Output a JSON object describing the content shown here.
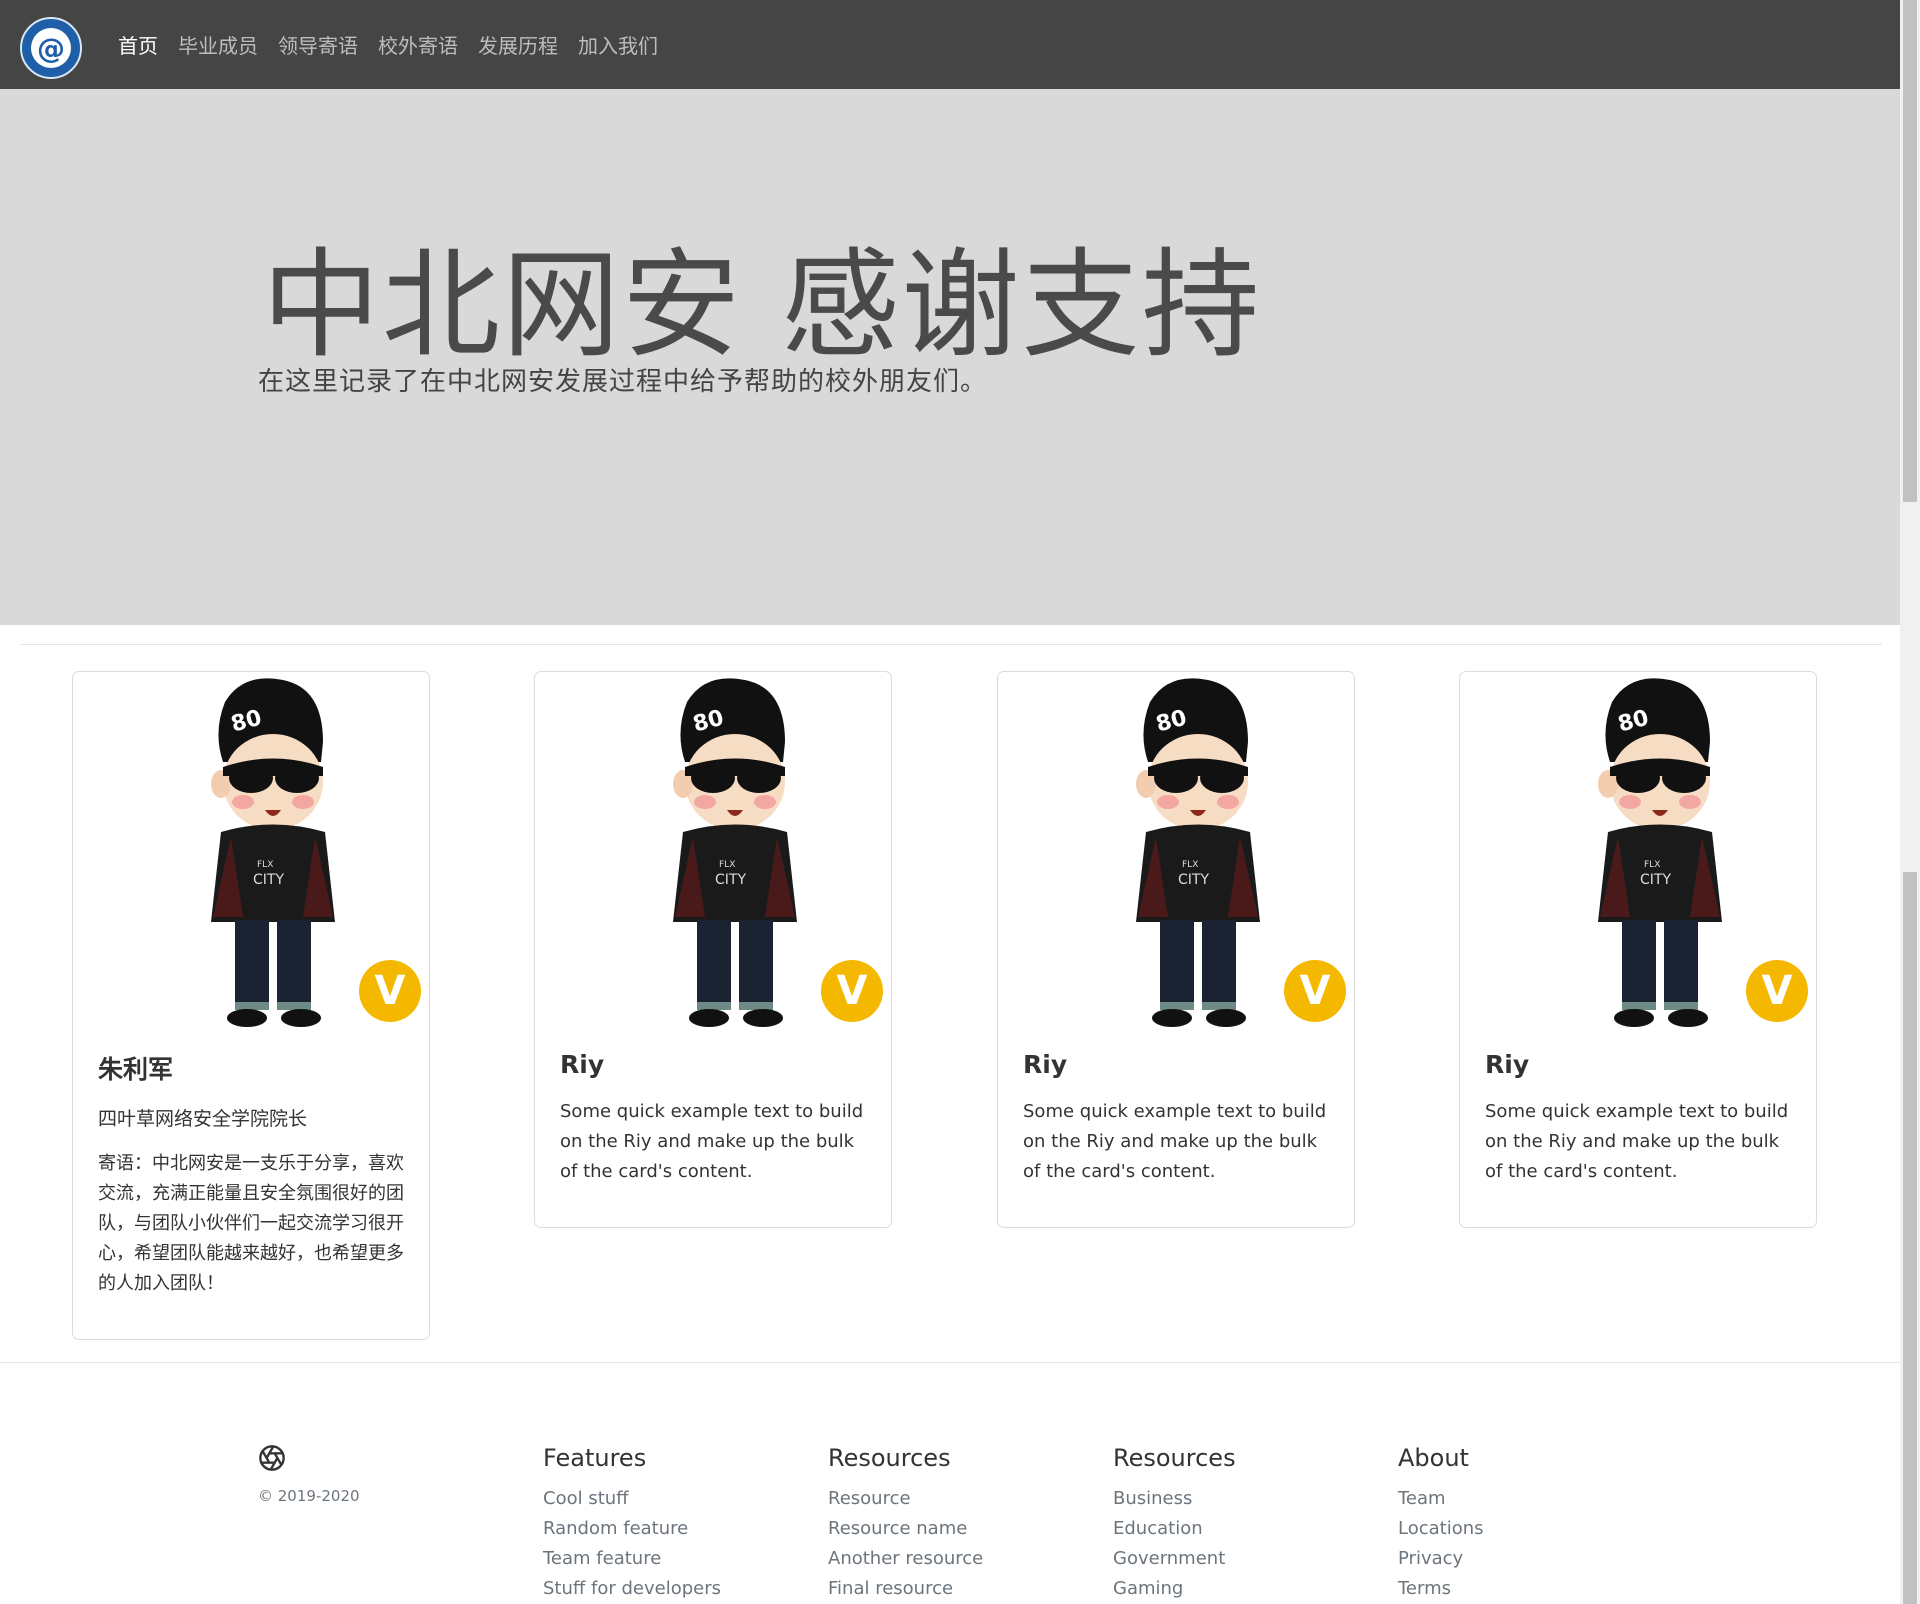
{
  "nav": {
    "logo_label": "@",
    "links": [
      "首页",
      "毕业成员",
      "领导寄语",
      "校外寄语",
      "发展历程",
      "加入我们"
    ]
  },
  "hero": {
    "title": "中北网安 感谢支持",
    "subtitle": "在这里记录了在中北网安发展过程中给予帮助的校外朋友们。"
  },
  "cards": [
    {
      "name": "朱利军",
      "subtitle": "四叶草网络安全学院院长",
      "text": "寄语：中北网安是一支乐于分享，喜欢交流，充满正能量且安全氛围很好的团队，与团队小伙伴们一起交流学习很开心，希望团队能越来越好，也希望更多的人加入团队！",
      "badge": "V"
    },
    {
      "name": "Riy",
      "subtitle": "",
      "text": "Some quick example text to build on the Riy and make up the bulk of the card's content.",
      "badge": "V"
    },
    {
      "name": "Riy",
      "subtitle": "",
      "text": "Some quick example text to build on the Riy and make up the bulk of the card's content.",
      "badge": "V"
    },
    {
      "name": "Riy",
      "subtitle": "",
      "text": "Some quick example text to build on the Riy and make up the bulk of the card's content.",
      "badge": "V"
    }
  ],
  "footer": {
    "copyright": "© 2019-2020",
    "columns": [
      {
        "title": "Features",
        "items": [
          "Cool stuff",
          "Random feature",
          "Team feature",
          "Stuff for developers"
        ]
      },
      {
        "title": "Resources",
        "items": [
          "Resource",
          "Resource name",
          "Another resource",
          "Final resource"
        ]
      },
      {
        "title": "Resources",
        "items": [
          "Business",
          "Education",
          "Government",
          "Gaming"
        ]
      },
      {
        "title": "About",
        "items": [
          "Team",
          "Locations",
          "Privacy",
          "Terms"
        ]
      }
    ]
  },
  "colors": {
    "navbar": "#454545",
    "jumbotron": "#d9d9d9",
    "badge": "#f5b800"
  }
}
